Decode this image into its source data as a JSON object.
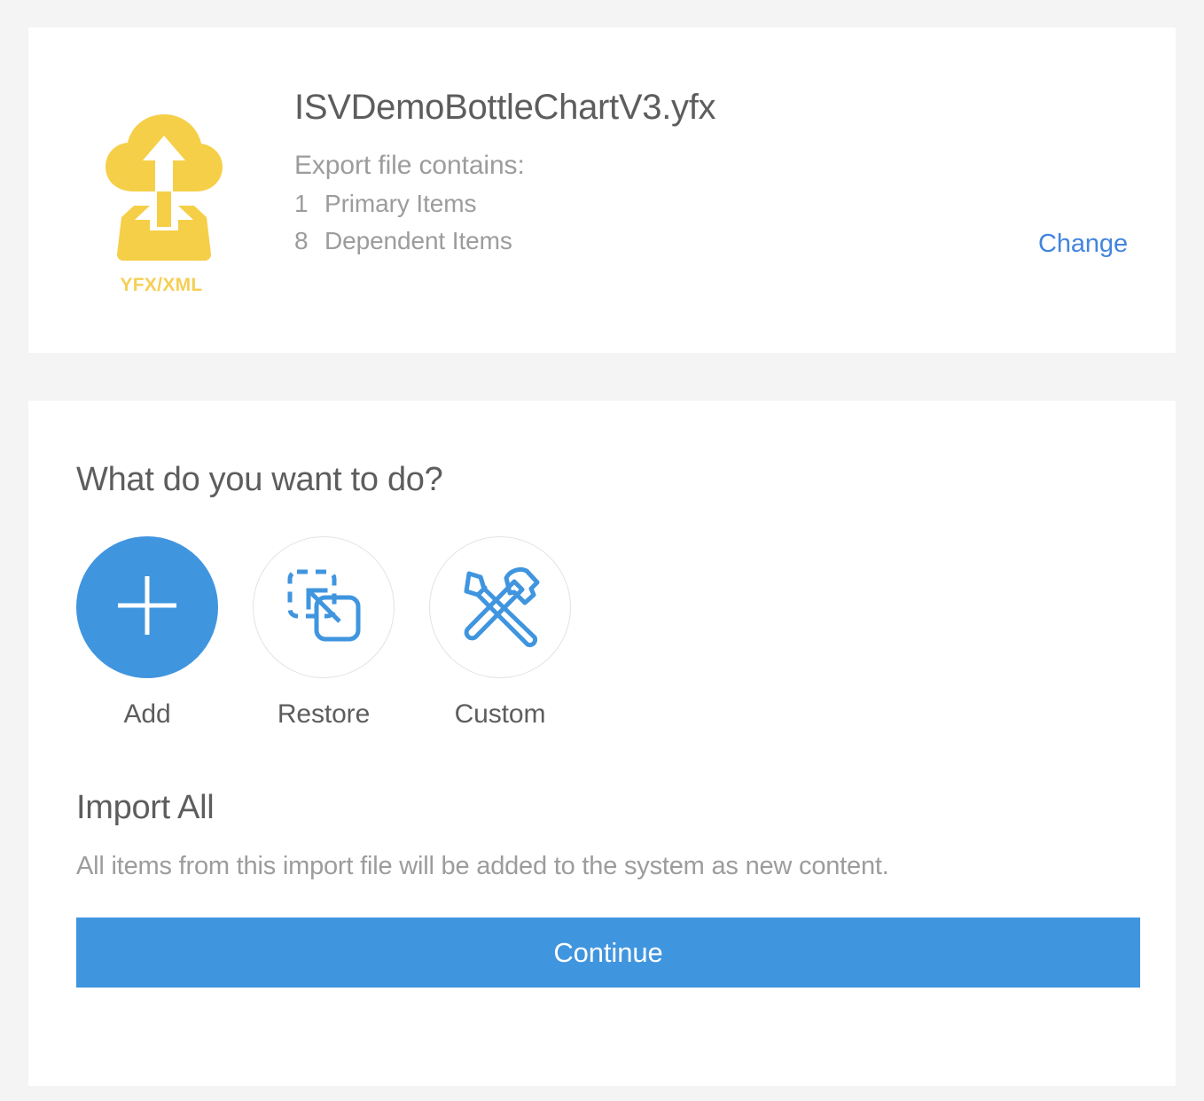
{
  "file_summary": {
    "icon_name": "cloud-upload-yfx-xml-icon",
    "icon_badge_label": "YFX/XML",
    "filename": "ISVDemoBottleChartV3.yfx",
    "contains_label": "Export file contains:",
    "contents": [
      {
        "count": "1",
        "label": "Primary Items"
      },
      {
        "count": "8",
        "label": "Dependent Items"
      }
    ],
    "change_link_label": "Change"
  },
  "action_chooser": {
    "question": "What do you want to do?",
    "choices": [
      {
        "label": "Add",
        "icon": "plus-icon",
        "selected": true
      },
      {
        "label": "Restore",
        "icon": "restore-select-icon",
        "selected": false
      },
      {
        "label": "Custom",
        "icon": "pencil-hammer-icon",
        "selected": false
      }
    ]
  },
  "import_section": {
    "title": "Import All",
    "description": "All items from this import file will be added to the system as new content.",
    "continue_label": "Continue"
  },
  "colors": {
    "accent_blue": "#4095df",
    "link_blue": "#4285dd",
    "icon_yellow": "#f5cf47",
    "page_background": "#f4f4f4",
    "card_background": "#ffffff",
    "text_dark": "#5d5d5d",
    "text_muted": "#9c9c9c"
  }
}
